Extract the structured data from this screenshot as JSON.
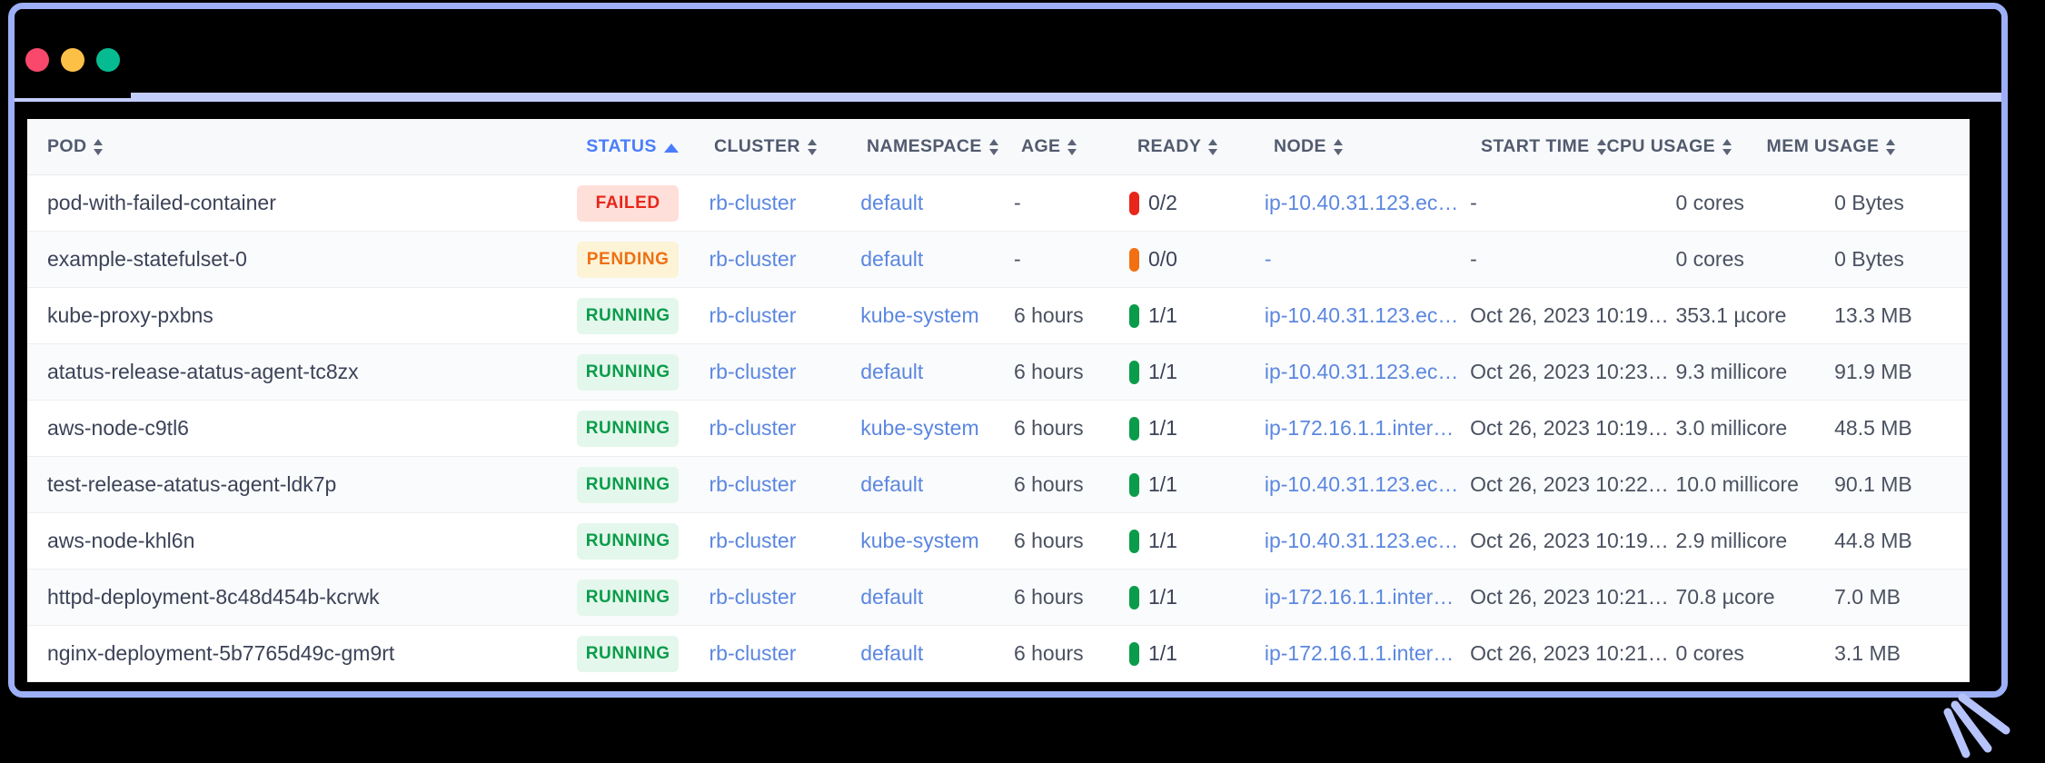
{
  "window": {
    "traffic_lights": [
      "close",
      "minimize",
      "maximize"
    ],
    "frame_color": "#9db0f7"
  },
  "table": {
    "columns": [
      {
        "key": "pod",
        "label": "POD",
        "sort": "both"
      },
      {
        "key": "status",
        "label": "STATUS",
        "sort": "asc"
      },
      {
        "key": "cluster",
        "label": "CLUSTER",
        "sort": "both"
      },
      {
        "key": "namespace",
        "label": "NAMESPACE",
        "sort": "both"
      },
      {
        "key": "age",
        "label": "AGE",
        "sort": "both"
      },
      {
        "key": "ready",
        "label": "READY",
        "sort": "both"
      },
      {
        "key": "node",
        "label": "NODE",
        "sort": "both"
      },
      {
        "key": "start_time",
        "label": "START TIME",
        "sort": "both"
      },
      {
        "key": "cpu",
        "label": "CPU USAGE",
        "sort": "both"
      },
      {
        "key": "mem",
        "label": "MEM USAGE",
        "sort": "both"
      }
    ],
    "sorted_by": "STATUS",
    "sort_direction": "ascending",
    "rows": [
      {
        "pod": "pod-with-failed-container",
        "status": "FAILED",
        "status_kind": "failed",
        "cluster": "rb-cluster",
        "namespace": "default",
        "age": "-",
        "ready": "0/2",
        "ready_kind": "red",
        "node": "ip-10.40.31.123.ec…",
        "node_link": true,
        "start_time": "-",
        "cpu": "0 cores",
        "mem": "0 Bytes"
      },
      {
        "pod": "example-statefulset-0",
        "status": "PENDING",
        "status_kind": "pending",
        "cluster": "rb-cluster",
        "namespace": "default",
        "age": "-",
        "ready": "0/0",
        "ready_kind": "orange",
        "node": "-",
        "node_link": true,
        "start_time": "-",
        "cpu": "0 cores",
        "mem": "0 Bytes"
      },
      {
        "pod": "kube-proxy-pxbns",
        "status": "RUNNING",
        "status_kind": "running",
        "cluster": "rb-cluster",
        "namespace": "kube-system",
        "age": "6 hours",
        "ready": "1/1",
        "ready_kind": "green",
        "node": "ip-10.40.31.123.ec…",
        "node_link": true,
        "start_time": "Oct 26, 2023 10:19…",
        "cpu": "353.1 µcore",
        "mem": "13.3 MB"
      },
      {
        "pod": "atatus-release-atatus-agent-tc8zx",
        "status": "RUNNING",
        "status_kind": "running",
        "cluster": "rb-cluster",
        "namespace": "default",
        "age": "6 hours",
        "ready": "1/1",
        "ready_kind": "green",
        "node": "ip-10.40.31.123.ec…",
        "node_link": true,
        "start_time": "Oct 26, 2023 10:23…",
        "cpu": "9.3 millicore",
        "mem": "91.9 MB"
      },
      {
        "pod": "aws-node-c9tl6",
        "status": "RUNNING",
        "status_kind": "running",
        "cluster": "rb-cluster",
        "namespace": "kube-system",
        "age": "6 hours",
        "ready": "1/1",
        "ready_kind": "green",
        "node": "ip-172.16.1.1.inter…",
        "node_link": true,
        "start_time": "Oct 26, 2023 10:19…",
        "cpu": "3.0 millicore",
        "mem": "48.5 MB"
      },
      {
        "pod": "test-release-atatus-agent-ldk7p",
        "status": "RUNNING",
        "status_kind": "running",
        "cluster": "rb-cluster",
        "namespace": "default",
        "age": "6 hours",
        "ready": "1/1",
        "ready_kind": "green",
        "node": "ip-10.40.31.123.ec…",
        "node_link": true,
        "start_time": "Oct 26, 2023 10:22…",
        "cpu": "10.0 millicore",
        "mem": "90.1 MB"
      },
      {
        "pod": "aws-node-khl6n",
        "status": "RUNNING",
        "status_kind": "running",
        "cluster": "rb-cluster",
        "namespace": "kube-system",
        "age": "6 hours",
        "ready": "1/1",
        "ready_kind": "green",
        "node": "ip-10.40.31.123.ec…",
        "node_link": true,
        "start_time": "Oct 26, 2023 10:19…",
        "cpu": "2.9 millicore",
        "mem": "44.8 MB"
      },
      {
        "pod": "httpd-deployment-8c48d454b-kcrwk",
        "status": "RUNNING",
        "status_kind": "running",
        "cluster": "rb-cluster",
        "namespace": "default",
        "age": "6 hours",
        "ready": "1/1",
        "ready_kind": "green",
        "node": "ip-172.16.1.1.inter…",
        "node_link": true,
        "start_time": "Oct 26, 2023 10:21…",
        "cpu": "70.8 µcore",
        "mem": "7.0 MB"
      },
      {
        "pod": "nginx-deployment-5b7765d49c-gm9rt",
        "status": "RUNNING",
        "status_kind": "running",
        "cluster": "rb-cluster",
        "namespace": "default",
        "age": "6 hours",
        "ready": "1/1",
        "ready_kind": "green",
        "node": "ip-172.16.1.1.inter…",
        "node_link": true,
        "start_time": "Oct 26, 2023 10:21…",
        "cpu": "0 cores",
        "mem": "3.1 MB"
      }
    ]
  },
  "colors": {
    "link": "#5b87e0",
    "sort_active": "#4a7dfc",
    "failed_text": "#e8261a",
    "failed_bg": "#ffdfd9",
    "pending_text": "#ee7014",
    "pending_bg": "#fdf3d6",
    "running_text": "#0a9c4a",
    "running_bg": "#e4f7ec"
  }
}
